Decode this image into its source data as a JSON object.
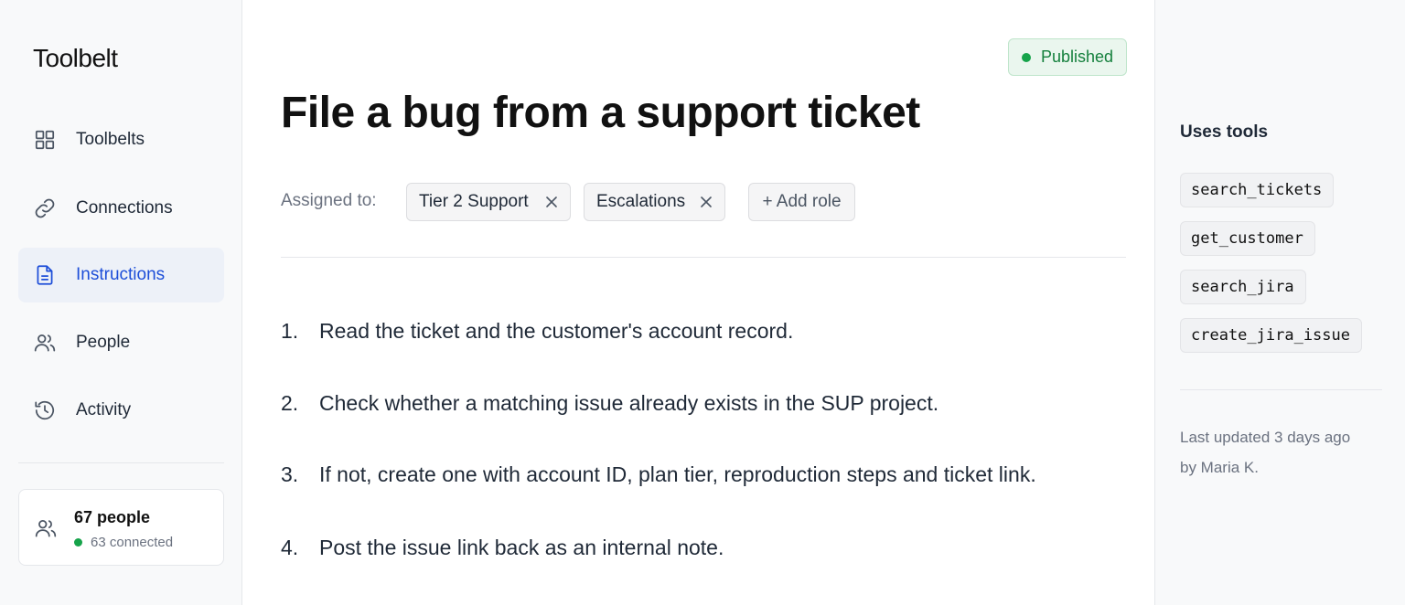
{
  "sidebar": {
    "brand": "Toolbelt",
    "items": [
      {
        "label": "Toolbelts",
        "icon": "grid-icon"
      },
      {
        "label": "Connections",
        "icon": "link-icon"
      },
      {
        "label": "Instructions",
        "icon": "document-icon",
        "active": true
      },
      {
        "label": "People",
        "icon": "people-icon"
      },
      {
        "label": "Activity",
        "icon": "history-icon"
      }
    ],
    "people_card": {
      "count": "67 people",
      "status": "63 connected",
      "status_color": "#16a34a"
    }
  },
  "main": {
    "status_badge": "Published",
    "title": "File a bug from a support ticket",
    "assigned_label": "Assigned to:",
    "roles": [
      "Tier 2 Support",
      "Escalations"
    ],
    "add_role_label": "+ Add role",
    "steps": [
      {
        "num": "1.",
        "text": "Read the ticket and the customer's account record."
      },
      {
        "num": "2.",
        "text": "Check whether a matching issue already exists in the SUP project."
      },
      {
        "num": "3.",
        "text": "If not, create one with account ID, plan tier, reproduction steps and ticket link."
      },
      {
        "num": "4.",
        "text": "Post the issue link back as an internal note."
      }
    ]
  },
  "right": {
    "uses_tools_title": "Uses tools",
    "tools": [
      "search_tickets",
      "get_customer",
      "search_jira",
      "create_jira_issue"
    ],
    "updated_line1": "Last updated 3 days ago",
    "updated_line2": "by Maria K."
  },
  "colors": {
    "accent": "#1d4ed8",
    "success": "#16a34a",
    "active_bg": "#edf1f8"
  }
}
